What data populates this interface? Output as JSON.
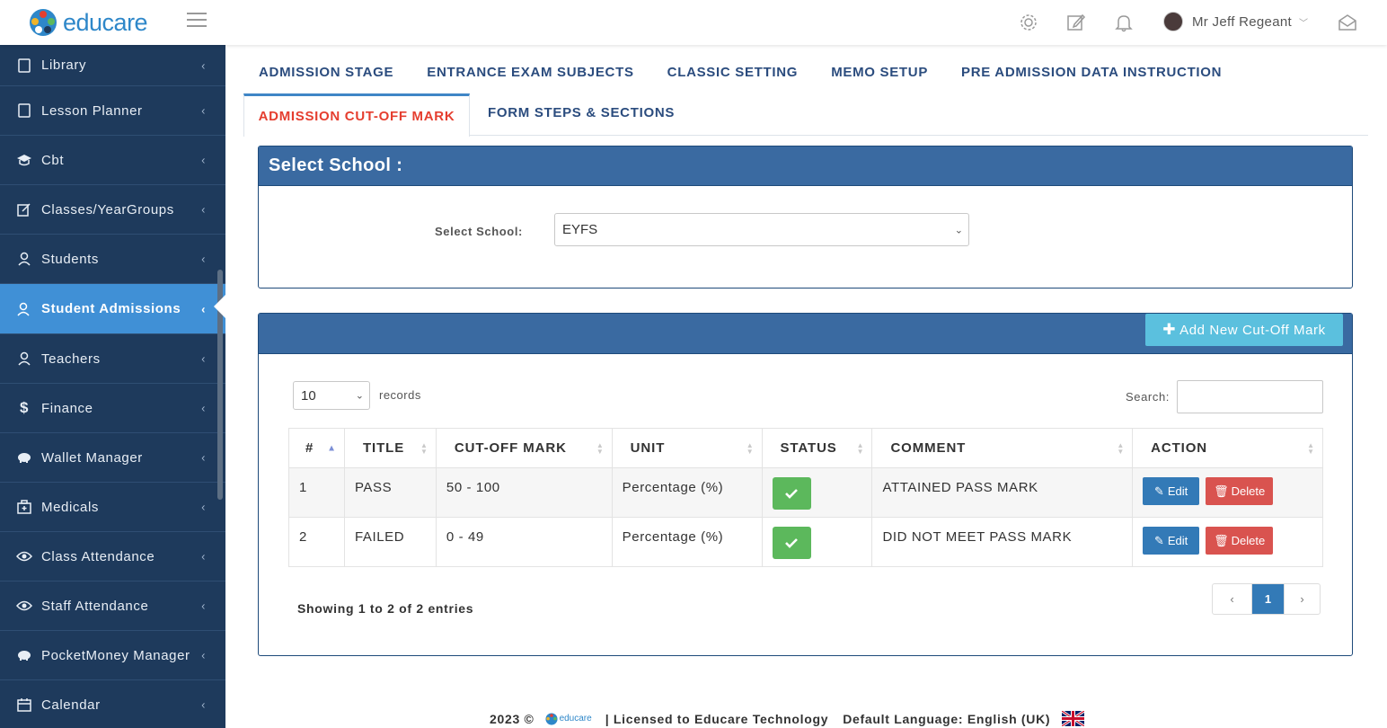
{
  "header": {
    "logo_text": "educare",
    "user_name": "Mr Jeff Regeant"
  },
  "sidebar": {
    "items": [
      {
        "label": "Library",
        "icon": "book-icon"
      },
      {
        "label": "Lesson Planner",
        "icon": "book-icon"
      },
      {
        "label": "Cbt",
        "icon": "graduation-cap-icon"
      },
      {
        "label": "Classes/YearGroups",
        "icon": "edit-icon"
      },
      {
        "label": "Students",
        "icon": "user-icon"
      },
      {
        "label": "Student Admissions",
        "icon": "users-icon",
        "active": true
      },
      {
        "label": "Teachers",
        "icon": "users-icon"
      },
      {
        "label": "Finance",
        "icon": "dollar-icon"
      },
      {
        "label": "Wallet Manager",
        "icon": "piggy-bank-icon"
      },
      {
        "label": "Medicals",
        "icon": "medical-kit-icon"
      },
      {
        "label": "Class Attendance",
        "icon": "eye-icon"
      },
      {
        "label": "Staff Attendance",
        "icon": "eye-icon"
      },
      {
        "label": "PocketMoney Manager",
        "icon": "piggy-bank-icon"
      },
      {
        "label": "Calendar",
        "icon": "calendar-icon"
      }
    ]
  },
  "tabs": {
    "row1": [
      "ADMISSION STAGE",
      "ENTRANCE EXAM SUBJECTS",
      "CLASSIC SETTING",
      "MEMO SETUP",
      "PRE ADMISSION DATA INSTRUCTION"
    ],
    "active": "ADMISSION CUT-OFF MARK",
    "second": "FORM STEPS & SECTIONS"
  },
  "school_panel": {
    "title": "Select School :",
    "label": "Select School:",
    "selected": "EYFS"
  },
  "list_panel": {
    "add_button": "Add New Cut-Off Mark",
    "page_size": "10",
    "records_label": "records",
    "search_label": "Search:",
    "columns": [
      "#",
      "TITLE",
      "CUT-OFF MARK",
      "UNIT",
      "STATUS",
      "COMMENT",
      "ACTION"
    ],
    "rows": [
      {
        "num": "1",
        "title": "PASS",
        "mark": "50 - 100",
        "unit": "Percentage (%)",
        "comment": "ATTAINED PASS MARK"
      },
      {
        "num": "2",
        "title": "FAILED",
        "mark": "0 - 49",
        "unit": "Percentage (%)",
        "comment": "DID NOT MEET PASS MARK"
      }
    ],
    "edit_label": "Edit",
    "delete_label": "Delete",
    "info": "Showing 1 to 2 of 2 entries",
    "pager": {
      "prev": "‹",
      "current": "1",
      "next": "›"
    }
  },
  "footer": {
    "year": "2023 ©",
    "mini_logo": "educare",
    "license": "|  Licensed to Educare Technology",
    "language": "Default Language: English (UK)"
  },
  "colors": {
    "sidebar_bg": "#1e3a5c",
    "sidebar_active": "#4090d6",
    "panel_head": "#3a6aa1",
    "tab_active": "#e53e2f",
    "tab_text": "#2b4c7e",
    "add_button": "#5bc0de",
    "edit_button": "#337ab7",
    "delete_button": "#d9534f",
    "status_ok": "#5cb85c"
  }
}
